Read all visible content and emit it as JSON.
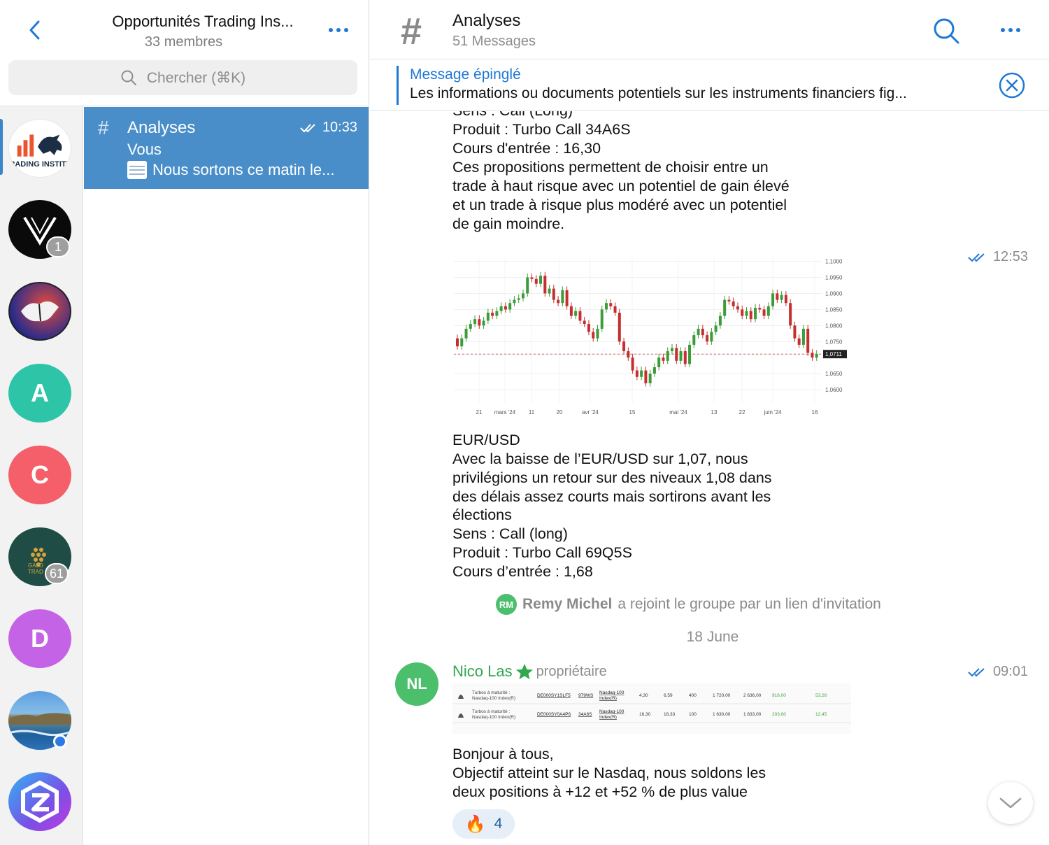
{
  "left_header": {
    "back_icon": "chevron-left-icon",
    "group_title": "Opportunités Trading Ins...",
    "member_count": "33 membres",
    "more_icon": "more-horizontal-icon",
    "search_placeholder": "Chercher (⌘K)"
  },
  "rail": {
    "avatars": [
      {
        "kind": "logo",
        "label": "RADING INSTITU",
        "selected": true
      },
      {
        "kind": "logo",
        "badge": "1"
      },
      {
        "kind": "logo"
      },
      {
        "kind": "letter",
        "letter": "A",
        "color": "#2dc4a8"
      },
      {
        "kind": "letter",
        "letter": "C",
        "color": "#f45f6a"
      },
      {
        "kind": "logo",
        "label": "GALD TRAD",
        "badge": "61"
      },
      {
        "kind": "letter",
        "letter": "D",
        "color": "#c563e6"
      },
      {
        "kind": "photo",
        "online": true
      },
      {
        "kind": "logo"
      }
    ]
  },
  "chat_list": {
    "selected": {
      "name": "Analyses",
      "time": "10:33",
      "sender": "Vous",
      "preview": "Nous sortons ce matin le..."
    }
  },
  "channel_header": {
    "title": "Analyses",
    "message_count": "51 Messages",
    "search_icon": "search-icon",
    "more_icon": "more-horizontal-icon"
  },
  "pinned": {
    "title": "Message épinglé",
    "text": "Les informations ou documents potentiels sur les instruments financiers fig...",
    "close_icon": "close-circle-icon"
  },
  "messages": {
    "msg1_lines": [
      "Sens : Call (Long)",
      "Produit : Turbo Call 34A6S",
      "Cours d'entrée : 16,30",
      "Ces propositions permettent de choisir entre un",
      "trade à haut risque avec un potentiel de gain élevé",
      "et un trade à risque plus modéré avec un potentiel",
      "de gain moindre."
    ],
    "msg2_time": "12:53",
    "chart": {
      "x_ticks": [
        "21",
        "mars '24",
        "11",
        "20",
        "avr '24",
        "15",
        "mai '24",
        "13",
        "22",
        "juin '24",
        "16"
      ],
      "y_ticks": [
        "1,1000",
        "1,0950",
        "1,0900",
        "1,0850",
        "1,0800",
        "1,0750",
        "1,0711",
        "1,0650",
        "1,0600"
      ],
      "current_price": "1,0711"
    },
    "msg2_lines": [
      "EUR/USD",
      "Avec la baisse de l’EUR/USD sur 1,07, nous",
      "privilégions un retour sur des niveaux 1,08 dans",
      "des délais assez courts mais sortirons avant les",
      "élections",
      "Sens : Call (long)",
      "Produit : Turbo Call 69Q5S",
      "Cours d’entrée : 1,68"
    ],
    "system": {
      "avatar": "RM",
      "name": "Remy Michel",
      "text": "a rejoint le groupe par un lien d'invitation"
    },
    "date_separator": "18 June",
    "msg3": {
      "avatar": "NL",
      "sender": "Nico Las",
      "role": "propriétaire",
      "time": "09:01",
      "table_rows": [
        {
          "desc1": "Turbos à maturité :",
          "desc2": "Nasdaq-100 Index(R)",
          "isin": "DE000SY1SLF5",
          "code": "979WS",
          "und1": "Nasdaq-100",
          "und2": "Index(R)",
          "v1": "4,30",
          "v2": "6,59",
          "v3": "400",
          "v4": "1 720,00",
          "v5": "2 636,00",
          "v6": "916,00",
          "v7": "53,26"
        },
        {
          "desc1": "Turbos à maturité :",
          "desc2": "Nasdaq-100 Index(R)",
          "isin": "DE000SY0A4P6",
          "code": "34A6S",
          "und1": "Nasdaq-100",
          "und2": "Index(R)",
          "v1": "16,30",
          "v2": "18,33",
          "v3": "100",
          "v4": "1 630,00",
          "v5": "1 833,00",
          "v6": "203,00",
          "v7": "12,45"
        }
      ],
      "lines": [
        "Bonjour à tous,",
        "Objectif atteint sur le Nasdaq, nous soldons les",
        "deux positions à +12 et +52 % de plus value"
      ],
      "reaction_emoji": "🔥",
      "reaction_count": "4"
    }
  },
  "colors": {
    "accent": "#1e78d6",
    "selected_chat": "#4a8ec9",
    "sender_green": "#2fa84f",
    "candle_up": "#3a9d3a",
    "candle_down": "#c62f2f"
  }
}
